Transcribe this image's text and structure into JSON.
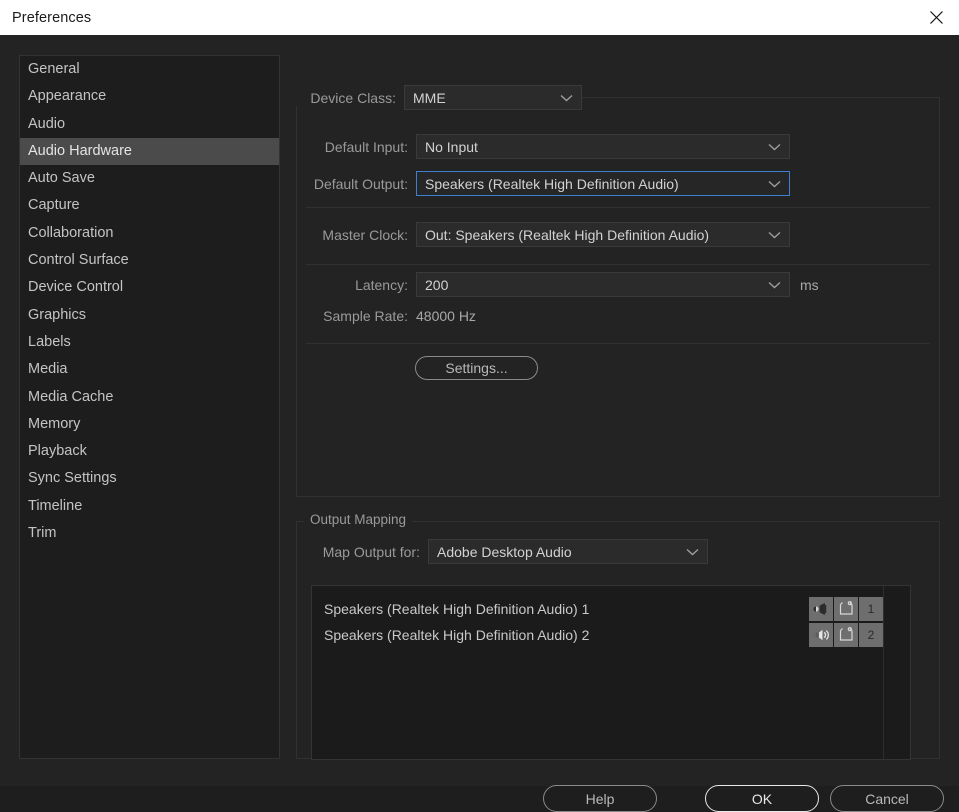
{
  "window": {
    "title": "Preferences",
    "close_icon": "close-icon"
  },
  "sidebar": {
    "items": [
      {
        "label": "General",
        "selected": false
      },
      {
        "label": "Appearance",
        "selected": false
      },
      {
        "label": "Audio",
        "selected": false
      },
      {
        "label": "Audio Hardware",
        "selected": true
      },
      {
        "label": "Auto Save",
        "selected": false
      },
      {
        "label": "Capture",
        "selected": false
      },
      {
        "label": "Collaboration",
        "selected": false
      },
      {
        "label": "Control Surface",
        "selected": false
      },
      {
        "label": "Device Control",
        "selected": false
      },
      {
        "label": "Graphics",
        "selected": false
      },
      {
        "label": "Labels",
        "selected": false
      },
      {
        "label": "Media",
        "selected": false
      },
      {
        "label": "Media Cache",
        "selected": false
      },
      {
        "label": "Memory",
        "selected": false
      },
      {
        "label": "Playback",
        "selected": false
      },
      {
        "label": "Sync Settings",
        "selected": false
      },
      {
        "label": "Timeline",
        "selected": false
      },
      {
        "label": "Trim",
        "selected": false
      }
    ]
  },
  "device_group": {
    "legend": "Device Class:",
    "device_class": {
      "label": "Device Class:",
      "value": "MME"
    },
    "default_input": {
      "label": "Default Input:",
      "value": "No Input"
    },
    "default_output": {
      "label": "Default Output:",
      "value": "Speakers (Realtek High Definition Audio)",
      "focused": true,
      "focus_color": "#3f7fd0"
    },
    "master_clock": {
      "label": "Master Clock:",
      "value": "Out: Speakers (Realtek High Definition Audio)"
    },
    "latency": {
      "label": "Latency:",
      "value": "200",
      "unit": "ms"
    },
    "sample_rate": {
      "label": "Sample Rate:",
      "value": "48000 Hz"
    },
    "settings_button": "Settings..."
  },
  "output_mapping": {
    "legend": "Output Mapping",
    "map_output_for": {
      "label": "Map Output for:",
      "value": "Adobe Desktop Audio"
    },
    "rows": [
      {
        "label": "Speakers (Realtek High Definition Audio) 1",
        "pan_icon": "speaker-left-icon",
        "clip_icon": "clip-frame-icon",
        "channel": "1"
      },
      {
        "label": "Speakers (Realtek High Definition Audio) 2",
        "pan_icon": "speaker-right-icon",
        "clip_icon": "clip-frame-icon",
        "channel": "2"
      }
    ]
  },
  "footer": {
    "help": "Help",
    "ok": "OK",
    "cancel": "Cancel"
  },
  "colors": {
    "dialog_bg": "#232323",
    "titlebar_bg": "#ffffff",
    "selection": "#4b4b4b",
    "accent": "#3f7fd0"
  }
}
